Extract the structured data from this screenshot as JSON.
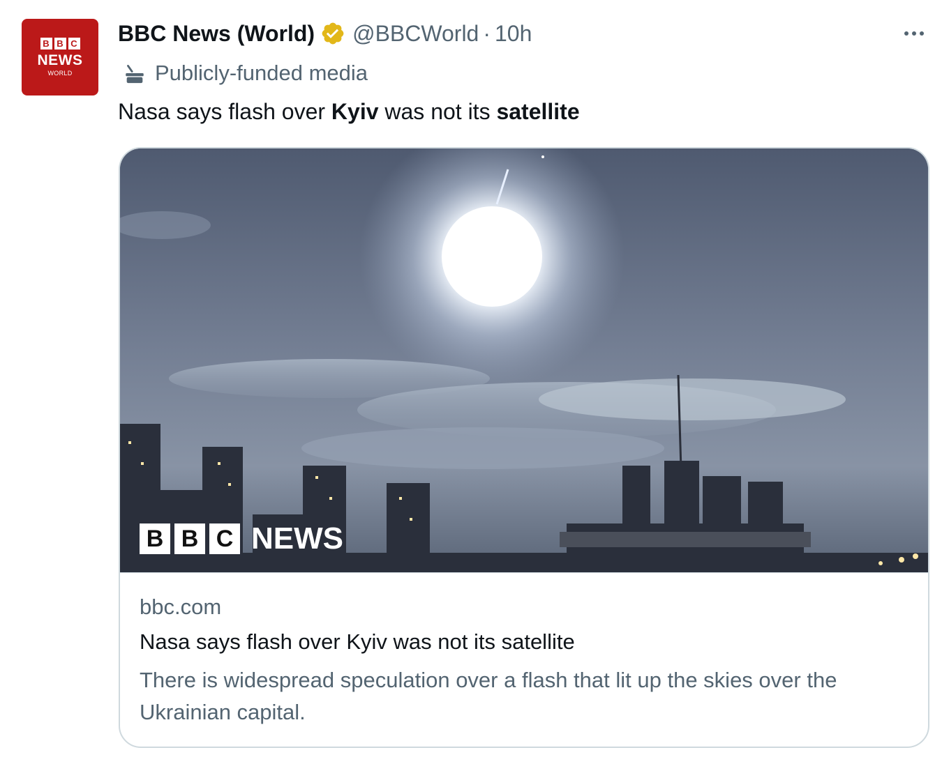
{
  "tweet": {
    "avatar": {
      "blocks": [
        "B",
        "B",
        "C"
      ],
      "line1": "NEWS",
      "line2": "WORLD",
      "bg_color": "#bb1919"
    },
    "display_name": "BBC News (World)",
    "verified_badge": "gold-verified-icon",
    "handle": "@BBCWorld",
    "separator": "·",
    "time": "10h",
    "more_icon": "more-horizontal-icon",
    "label": {
      "icon": "government-building-icon",
      "text": "Publicly-funded media"
    },
    "text_parts": {
      "p1": "Nasa says flash over ",
      "p2": "Kyiv",
      "p3": " was not its ",
      "p4": "satellite"
    },
    "card": {
      "watermark_blocks": [
        "B",
        "B",
        "C"
      ],
      "watermark_text": "NEWS",
      "domain": "bbc.com",
      "title": "Nasa says flash over Kyiv was not its satellite",
      "description": "There is widespread speculation over a flash that lit up the skies over the Ukrainian capital."
    }
  },
  "colors": {
    "primary_text": "#0f1419",
    "secondary_text": "#536471",
    "border": "#cfd9de",
    "verified_gold": "#e2b719",
    "bbc_red": "#bb1919"
  }
}
